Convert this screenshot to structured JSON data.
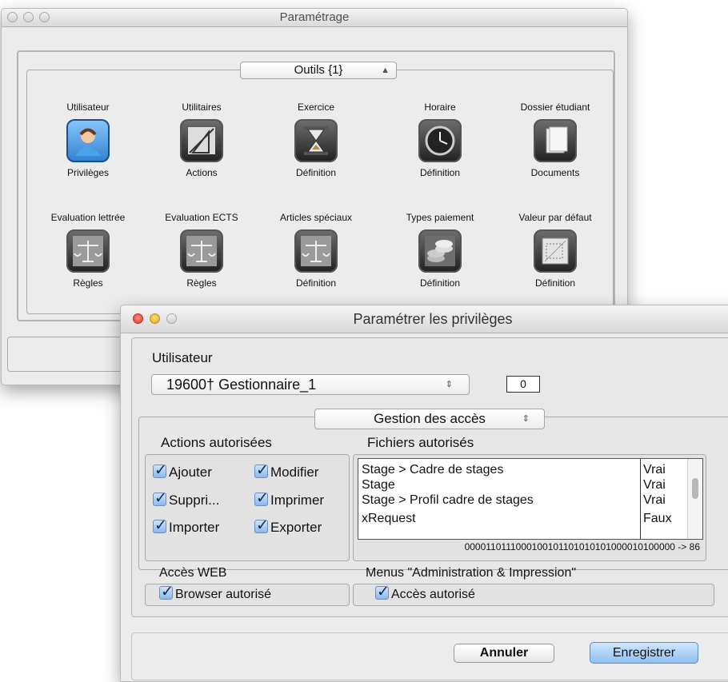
{
  "back_window": {
    "title": "Paramétrage",
    "popup": "Outils {1}",
    "tools": [
      {
        "top": "Utilisateur",
        "bottom": "Privilèges",
        "icon": "user-icon"
      },
      {
        "top": "Utilitaires",
        "bottom": "Actions",
        "icon": "drafting-tools-icon"
      },
      {
        "top": "Exercice",
        "bottom": "Définition",
        "icon": "hourglass-icon"
      },
      {
        "top": "Horaire",
        "bottom": "Définition",
        "icon": "clock-icon"
      },
      {
        "top": "Dossier étudiant",
        "bottom": "Documents",
        "icon": "documents-icon"
      },
      {
        "top": "Evaluation lettrée",
        "bottom": "Règles",
        "icon": "scales-icon"
      },
      {
        "top": "Evaluation ECTS",
        "bottom": "Règles",
        "icon": "scales-icon"
      },
      {
        "top": "Articles spéciaux",
        "bottom": "Définition",
        "icon": "scales-icon"
      },
      {
        "top": "Types paiement",
        "bottom": "Définition",
        "icon": "coins-icon"
      },
      {
        "top": "Valeur par défaut",
        "bottom": "Définition",
        "icon": "blueprint-icon"
      }
    ]
  },
  "dialog": {
    "title": "Paramétrer les privilèges",
    "user_label": "Utilisateur",
    "user_value": "19600† Gestionnaire_1",
    "user_count": "0",
    "section_popup": "Gestion des accès",
    "actions_label": "Actions autorisées",
    "actions": [
      "Ajouter",
      "Modifier",
      "Suppri...",
      "Imprimer",
      "Importer",
      "Exporter"
    ],
    "files_label": "Fichiers autorisés",
    "files": [
      {
        "name": "Stage > Cadre de stages",
        "value": "Vrai"
      },
      {
        "name": "Stage",
        "value": "Vrai"
      },
      {
        "name": "Stage > Profil cadre de stages",
        "value": "Vrai"
      },
      {
        "name": "xRequest",
        "value": "Faux"
      }
    ],
    "bitstring": "0000110111000100101101010101000010100000 -> 86",
    "web_label": "Accès WEB",
    "web_checkbox": "Browser autorisé",
    "menus_label": "Menus \"Administration & Impression\"",
    "menus_checkbox": "Accès autorisé",
    "cancel_button": "Annuler",
    "save_button": "Enregistrer"
  },
  "colors": {
    "default_button": "#8fc0f2",
    "checkbox": "#8db7ec"
  }
}
